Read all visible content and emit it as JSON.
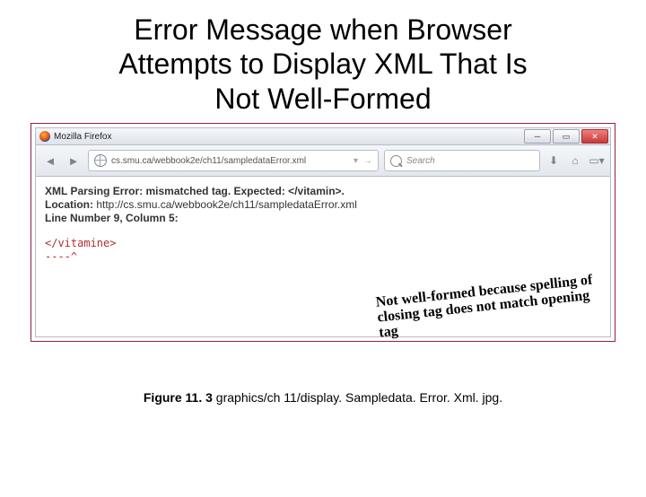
{
  "title_line1": "Error Message when Browser",
  "title_line2": "Attempts to Display XML That Is",
  "title_line3": "Not Well-Formed",
  "window_title": "Mozilla Firefox",
  "url": "cs.smu.ca/webbook2e/ch11/sampledataError.xml",
  "search_placeholder": "Search",
  "error_label": "XML Parsing Error: mismatched tag. Expected: </vitamin>.",
  "location_label": "Location:",
  "location_value": "http://cs.smu.ca/webbook2e/ch11/sampledataError.xml",
  "line_label": "Line Number 9, Column 5:",
  "snippet": "</vitamine>",
  "dashes": "----^",
  "annotation_l1": "Not well-formed because spelling of",
  "annotation_l2": "closing tag does not match opening tag",
  "caption_bold": "Figure 11. 3",
  "caption_rest": "  graphics/ch 11/display. Sampledata. Error. Xml. jpg."
}
